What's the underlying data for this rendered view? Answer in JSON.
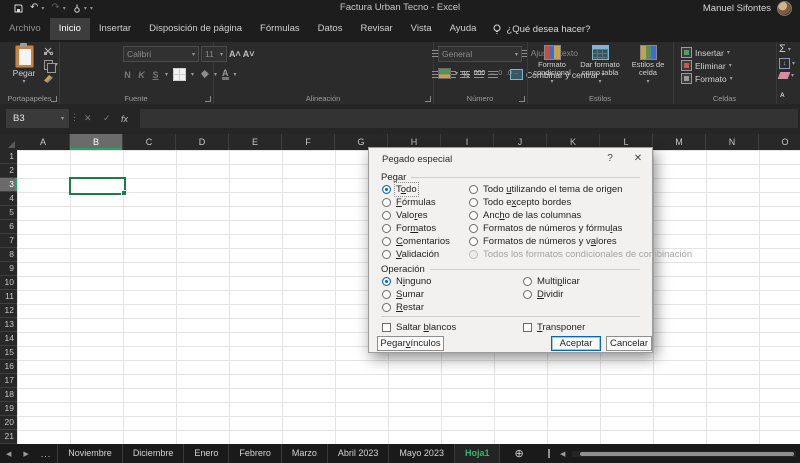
{
  "window": {
    "title": "Factura Urban Tecno  -  Excel",
    "user": "Manuel Sifontes"
  },
  "quick_access": {
    "icons": [
      "save",
      "undo",
      "redo",
      "touch-mode",
      "customize-toolbar"
    ]
  },
  "menu": {
    "tabs": [
      {
        "label": "Archivo"
      },
      {
        "label": "Inicio",
        "active": true
      },
      {
        "label": "Insertar"
      },
      {
        "label": "Disposición de página"
      },
      {
        "label": "Fórmulas"
      },
      {
        "label": "Datos"
      },
      {
        "label": "Revisar"
      },
      {
        "label": "Vista"
      },
      {
        "label": "Ayuda"
      }
    ],
    "tellme": "¿Qué desea hacer?"
  },
  "ribbon": {
    "paste": "Pegar",
    "clipboard_group": "Portapapeles",
    "font_name": "Calibri",
    "font_size": "11",
    "bold": "N",
    "italic": "K",
    "underline": "S",
    "font_group": "Fuente",
    "wrap_text": "Ajustar texto",
    "merge_center": "Combinar y centrar",
    "alignment_group": "Alineación",
    "number_format": "General",
    "percent": "%",
    "thousands": "000",
    "number_group": "Número",
    "conditional_formatting": "Formato condicional",
    "format_as_table": "Dar formato como tabla",
    "cell_styles": "Estilos de celda",
    "styles_group": "Estilos",
    "insert": "Insertar",
    "delete": "Eliminar",
    "format": "Formato",
    "cells_group": "Celdas",
    "sort_filter": "Ordenar y filtrar"
  },
  "formula_bar": {
    "cell_ref": "B3",
    "fx": "fx",
    "formula": ""
  },
  "grid": {
    "columns": [
      "A",
      "B",
      "C",
      "D",
      "E",
      "F",
      "G",
      "H",
      "I",
      "J",
      "K",
      "L",
      "M",
      "N",
      "O"
    ],
    "rows": [
      1,
      2,
      3,
      4,
      5,
      6,
      7,
      8,
      9,
      10,
      11,
      12,
      13,
      14,
      15,
      16,
      17,
      18,
      19,
      20,
      21
    ],
    "selected_column": "B",
    "selected_row": 3,
    "selected_cell": "B3"
  },
  "dialog": {
    "title": "Pegado especial",
    "paste_group": "Pegar",
    "paste_left": [
      {
        "label": "Todo",
        "u": 1,
        "checked": true,
        "focus": true
      },
      {
        "label": "Fórmulas",
        "u": 0
      },
      {
        "label": "Valores",
        "u": 4
      },
      {
        "label": "Formatos",
        "u": 3
      },
      {
        "label": "Comentarios",
        "u": 0
      },
      {
        "label": "Validación",
        "u": 0
      }
    ],
    "paste_right": [
      {
        "label": "Todo utilizando el tema de origen",
        "u": 5
      },
      {
        "label": "Todo excepto bordes",
        "u": 6
      },
      {
        "label": "Ancho de las columnas",
        "u": 3
      },
      {
        "label": "Formatos de números y fórmulas",
        "u": 27
      },
      {
        "label": "Formatos de números y valores",
        "u": 23
      },
      {
        "label": "Todos los formatos condicionales de combinación",
        "disabled": true
      }
    ],
    "operation_group": "Operación",
    "operation_left": [
      {
        "label": "Ninguno",
        "u": 1,
        "checked": true
      },
      {
        "label": "Sumar",
        "u": 0
      },
      {
        "label": "Restar",
        "u": 0
      }
    ],
    "operation_right": [
      {
        "label": "Multiplicar",
        "u": 5
      },
      {
        "label": "Dividir",
        "u": 0
      }
    ],
    "skip_blanks": {
      "label": "Saltar blancos",
      "u": 7
    },
    "transpose": {
      "label": "Transponer",
      "u": 0
    },
    "paste_link_button": {
      "label": "Pegar vínculos",
      "u": 6
    },
    "ok_button": {
      "label": "Aceptar",
      "default": true
    },
    "cancel_button": {
      "label": "Cancelar"
    }
  },
  "sheet_bar": {
    "overflow": "...",
    "tabs": [
      "Noviembre",
      "Diciembre",
      "Enero",
      "Febrero",
      "Marzo",
      "Abril 2023",
      "Mayo 2023",
      "Hoja1"
    ],
    "active_tab": "Hoja1"
  },
  "colors": {
    "excel_selection_green": "#1a7f47",
    "header_accent_green": "#21a366",
    "active_tab_green": "#3ab36f",
    "radio_blue": "#0067c0",
    "clipboard_orange": "#c98241",
    "dialog_bg": "#f2f1f0"
  }
}
